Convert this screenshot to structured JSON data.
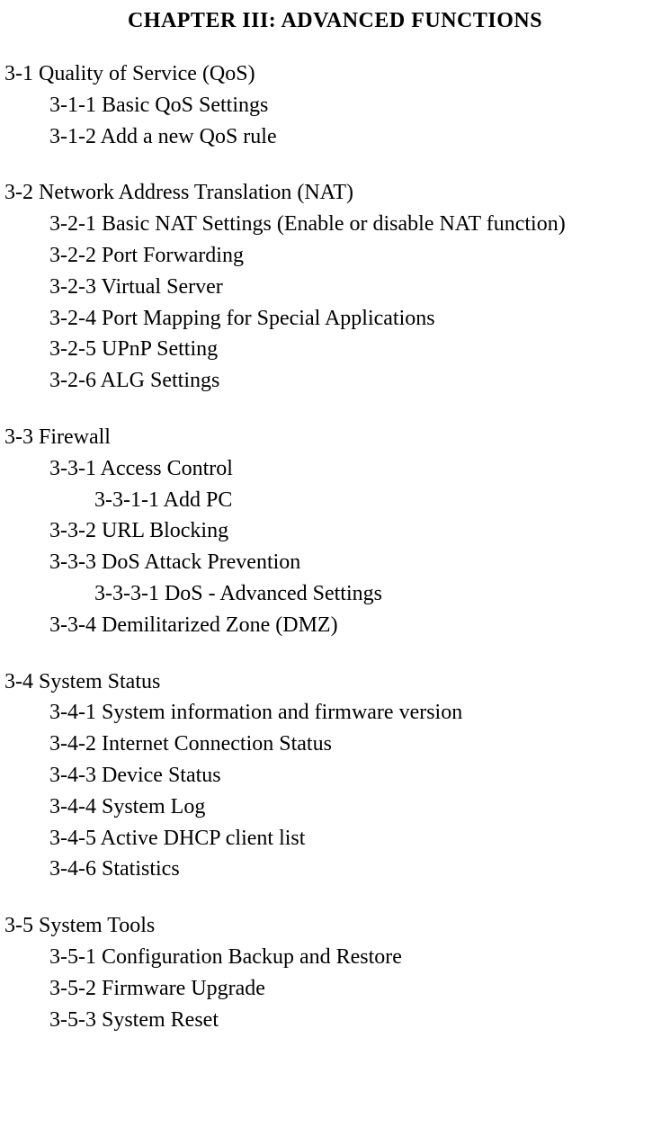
{
  "chapter_title": "CHAPTER III:    ADVANCED FUNCTIONS",
  "sections": [
    {
      "heading": "3-1 Quality of Service (QoS)",
      "items": [
        {
          "level": 1,
          "text": "3-1-1 Basic QoS Settings"
        },
        {
          "level": 1,
          "text": "3-1-2 Add a new QoS rule"
        }
      ]
    },
    {
      "heading": "3-2 Network Address Translation (NAT)",
      "items": [
        {
          "level": 1,
          "text": "3-2-1 Basic NAT Settings (Enable or disable NAT function)"
        },
        {
          "level": 1,
          "text": "3-2-2 Port Forwarding"
        },
        {
          "level": 1,
          "text": "3-2-3 Virtual Server"
        },
        {
          "level": 1,
          "text": "3-2-4 Port Mapping for Special Applications"
        },
        {
          "level": 1,
          "text": "3-2-5 UPnP Setting"
        },
        {
          "level": 1,
          "text": "3-2-6 ALG Settings"
        }
      ]
    },
    {
      "heading": "3-3 Firewall",
      "items": [
        {
          "level": 1,
          "text": "3-3-1 Access Control"
        },
        {
          "level": 2,
          "text": "3-3-1-1 Add PC"
        },
        {
          "level": 1,
          "text": "3-3-2 URL Blocking"
        },
        {
          "level": 1,
          "text": "3-3-3 DoS Attack Prevention"
        },
        {
          "level": 2,
          "text": "3-3-3-1 DoS - Advanced Settings"
        },
        {
          "level": 1,
          "text": "3-3-4 Demilitarized Zone (DMZ)"
        }
      ]
    },
    {
      "heading": "3-4 System Status",
      "items": [
        {
          "level": 1,
          "text": "3-4-1 System information and firmware version"
        },
        {
          "level": 1,
          "text": "3-4-2 Internet Connection Status"
        },
        {
          "level": 1,
          "text": "3-4-3 Device Status"
        },
        {
          "level": 1,
          "text": "3-4-4 System Log"
        },
        {
          "level": 1,
          "text": "3-4-5 Active DHCP client list"
        },
        {
          "level": 1,
          "text": "3-4-6 Statistics"
        }
      ]
    },
    {
      "heading": "3-5 System Tools",
      "items": [
        {
          "level": 1,
          "text": "3-5-1 Configuration Backup and Restore"
        },
        {
          "level": 1,
          "text": "3-5-2 Firmware Upgrade"
        },
        {
          "level": 1,
          "text": "3-5-3 System Reset"
        }
      ]
    }
  ]
}
